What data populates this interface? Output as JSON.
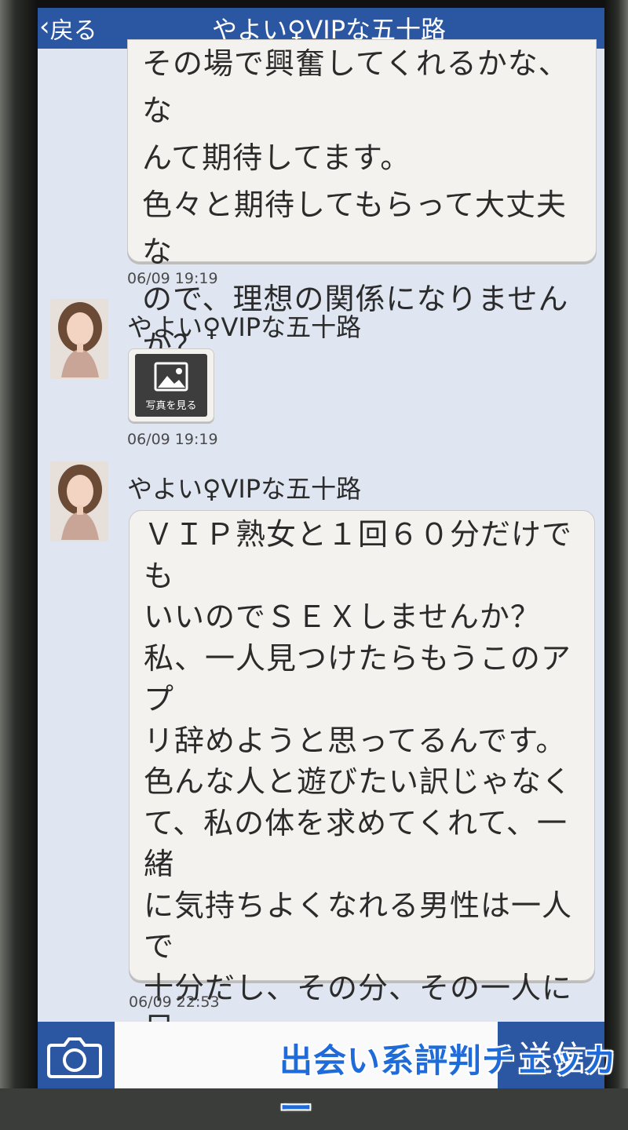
{
  "header": {
    "back_label": "戻る",
    "title": "やよい♀VIPな五十路"
  },
  "messages": [
    {
      "text": "その場で興奮してくれるかな、な\nんて期待してます。\n色々と期待してもらって大丈夫な\nので、理想の関係になりません\nか？",
      "timestamp": "06/09 19:19"
    },
    {
      "sender": "やよい♀VIPな五十路",
      "photo_label": "写真を見る",
      "timestamp": "06/09 19:19"
    },
    {
      "sender": "やよい♀VIPな五十路",
      "text": "ＶＩＰ熟女と１回６０分だけでも\nいいのでＳＥＸしませんか？\n私、一人見つけたらもうこのアプ\nリ辞めようと思ってるんです。\n色んな人と遊びたい訳じゃなく\nて、私の体を求めてくれて、一緒\nに気持ちよくなれる男性は一人で\n十分だし、その分、その一人に尽\nくしたいと思ってます。\n私の気持ち、受取ってくれません\nか？",
      "timestamp": "06/09 22:53"
    }
  ],
  "footer": {
    "send_label": "送信",
    "input_value": ""
  },
  "watermark": "出会い系評判チェッカー",
  "colors": {
    "accent": "#2b56a2",
    "background": "#dfe5f1",
    "bubble": "#f3f2ef"
  },
  "icons": [
    "back-chevron-icon",
    "image-icon",
    "camera-icon"
  ]
}
